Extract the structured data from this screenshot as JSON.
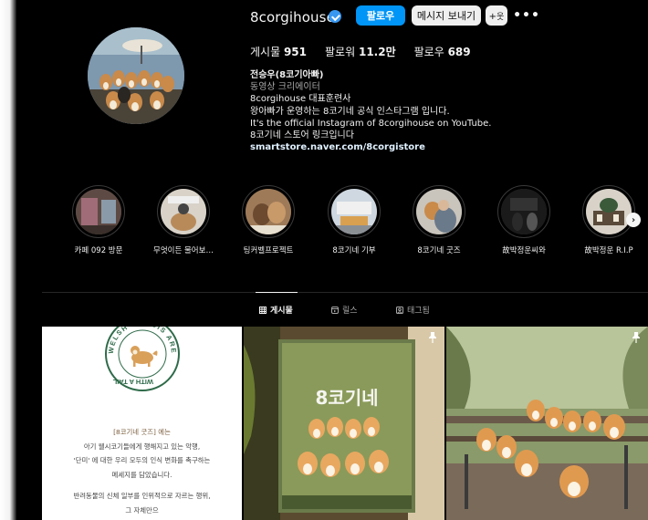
{
  "profile": {
    "username": "8corgihouse",
    "verified": true,
    "follow_label": "팔로우",
    "message_label": "메시지 보내기",
    "add_label": "+",
    "more_label": "•••"
  },
  "stats": {
    "posts_label": "게시물",
    "posts_value": "951",
    "followers_label": "팔로워",
    "followers_value": "11.2만",
    "following_label": "팔로우",
    "following_value": "689"
  },
  "bio": {
    "name": "전승우(8코기아빠)",
    "category": "동영상 크리에이터",
    "lines": [
      "8corgihouse 대표훈련사",
      "왕아빠가 운영하는 8코기네 공식 인스타그램 입니다.",
      "It's the official Instagram of 8corgihouse on YouTube.",
      "8코기네 스토어 링크입니다"
    ],
    "link": "smartstore.naver.com/8corgistore"
  },
  "highlights": [
    {
      "label": "카페 092 방문"
    },
    {
      "label": "무엇이든 물어보세요"
    },
    {
      "label": "팅커벨프로젝트"
    },
    {
      "label": "8코기네 기부"
    },
    {
      "label": "8코기네 굿즈"
    },
    {
      "label": "故박정운씨와"
    },
    {
      "label": "故박정운 R.I.P"
    }
  ],
  "tabs": [
    {
      "label": "게시물",
      "icon": "grid-icon"
    },
    {
      "label": "릴스",
      "icon": "reels-icon"
    },
    {
      "label": "태그됨",
      "icon": "tagged-icon"
    }
  ],
  "posts": {
    "post1": {
      "seal_text": "WELSH CORGIS ARE BORN WITH A TAIL",
      "lines": [
        "[8코기네 굿즈] 에는",
        "아기 웰시코기들에게 행해지고 있는 악행,",
        "'단미' 에 대한 우리 모두의 인식 변화를 촉구하는",
        "메세지를 담았습니다.",
        "",
        "반려동물의 신체 일부를 인위적으로 자르는 행위,",
        "그 자체만으"
      ]
    },
    "post2": {
      "book_title": "8코기네"
    }
  },
  "colors": {
    "background": "#000000",
    "accent": "#0095f6",
    "verified": "#3897f0"
  }
}
